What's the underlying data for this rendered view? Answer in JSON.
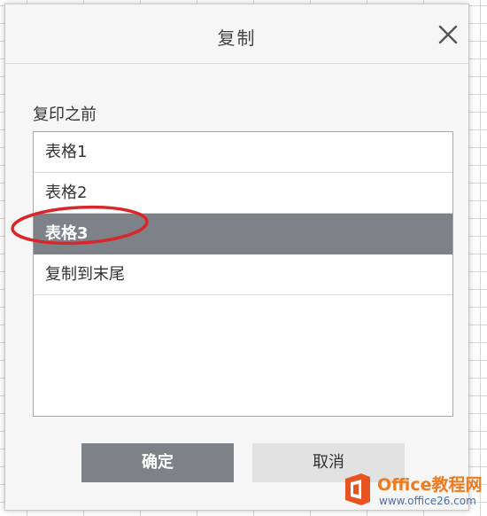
{
  "dialog": {
    "title": "复制",
    "close_icon": "close-icon",
    "section_label": "复印之前",
    "list": [
      {
        "label": "表格1",
        "selected": false
      },
      {
        "label": "表格2",
        "selected": false
      },
      {
        "label": "表格3",
        "selected": true
      },
      {
        "label": "复制到末尾",
        "selected": false
      }
    ],
    "ok_label": "确定",
    "cancel_label": "取消"
  },
  "watermark": {
    "name": "Office教程网",
    "url": "www.office26.com"
  },
  "colors": {
    "selection": "#7d8188",
    "annotation_ring": "#d9262b",
    "brand_orange": "#f07a1c"
  }
}
